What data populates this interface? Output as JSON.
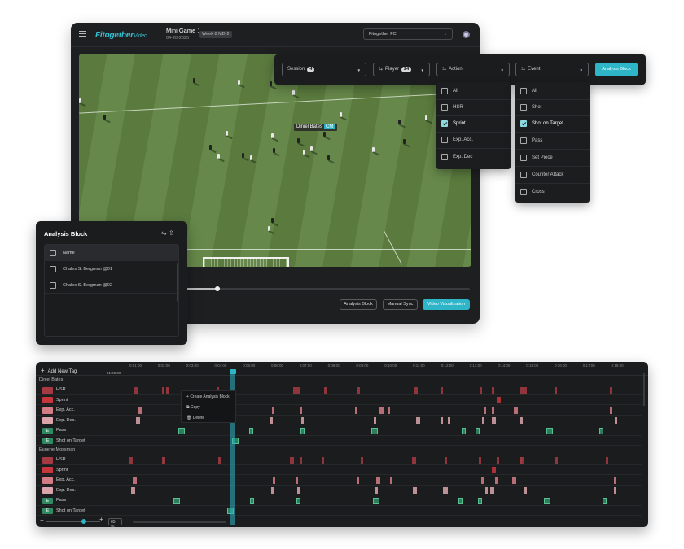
{
  "header": {
    "logo": "Fitogether",
    "logo_suffix": "Video",
    "game_title": "Mini Game 1",
    "game_date": "04-20-2025",
    "week_badge": "Week 8 MD-2",
    "team_select": "Fitogether FC"
  },
  "video": {
    "player_tag_name": "Diniel Bates",
    "player_tag_position": "CM",
    "progress": 0.11
  },
  "video_buttons": {
    "analysis_block": "Analysis Block",
    "manual_sync": "Manual Sync",
    "video_visualization": "Video Visualization"
  },
  "filters": {
    "session_label": "Session",
    "session_count": "4",
    "player_label": "Player",
    "player_count": "24",
    "action_label": "Action",
    "event_label": "Event",
    "analysis_block_button": "Analysis Block"
  },
  "action_dropdown": {
    "items": [
      {
        "label": "All",
        "checked": false
      },
      {
        "label": "HSR",
        "checked": false
      },
      {
        "label": "Sprint",
        "checked": true
      },
      {
        "label": "Exp. Acc.",
        "checked": false
      },
      {
        "label": "Exp. Dec",
        "checked": false
      }
    ]
  },
  "event_dropdown": {
    "items": [
      {
        "label": "All",
        "checked": false
      },
      {
        "label": "Shot",
        "checked": false
      },
      {
        "label": "Shot on Target",
        "checked": true
      },
      {
        "label": "Pass",
        "checked": false
      },
      {
        "label": "Set Piece",
        "checked": false
      },
      {
        "label": "Counter Attack",
        "checked": false
      },
      {
        "label": "Cross",
        "checked": false
      }
    ]
  },
  "analysis_panel": {
    "title": "Analysis Block",
    "column_name": "Name",
    "rows": [
      "Chales S. Bergman @01",
      "Chales S. Bergman @02"
    ]
  },
  "timeline": {
    "add_tag": "Add New Tag",
    "start_time": "01:40:00",
    "ticks": [
      "0:01:00",
      "0:02:00",
      "0:03:00",
      "0:04:00",
      "0:05:00",
      "0:06:00",
      "0:07:00",
      "0:08:00",
      "0:09:00",
      "0:10:00",
      "0:11:00",
      "0:12:00",
      "0:13:00",
      "0:14:00",
      "0:15:00",
      "0:16:00",
      "0:17:00",
      "0:18:00"
    ],
    "groups": [
      {
        "name": "Diniel Bates",
        "rows": [
          {
            "label": "HSR",
            "badge": "",
            "color": "#a63a42"
          },
          {
            "label": "Sprint",
            "badge": "",
            "color": "#c5363d"
          },
          {
            "label": "Exp. Acc.",
            "badge": "",
            "color": "#d47c86"
          },
          {
            "label": "Exp. Dec.",
            "badge": "",
            "color": "#d9a5ab"
          },
          {
            "label": "Pass",
            "badge": "E",
            "color": "#2f8a63"
          },
          {
            "label": "Shot on Target",
            "badge": "E",
            "color": "#2f8a63"
          }
        ]
      },
      {
        "name": "Eugene Mossman",
        "rows": [
          {
            "label": "HSR",
            "badge": "",
            "color": "#a63a42"
          },
          {
            "label": "Sprint",
            "badge": "",
            "color": "#c5363d"
          },
          {
            "label": "Exp. Acc.",
            "badge": "",
            "color": "#d47c86"
          },
          {
            "label": "Exp. Dec.",
            "badge": "",
            "color": "#d9a5ab"
          },
          {
            "label": "Pass",
            "badge": "E",
            "color": "#2f8a63"
          },
          {
            "label": "Shot on Target",
            "badge": "E",
            "color": "#2f8a63"
          }
        ]
      }
    ],
    "context_menu": [
      "Create Analysis Block",
      "Copy",
      "Delete"
    ],
    "zoom_value": "65",
    "zoom_unit": "%"
  },
  "colors": {
    "accent": "#2eb6c8",
    "panel": "#1b1c1e"
  }
}
